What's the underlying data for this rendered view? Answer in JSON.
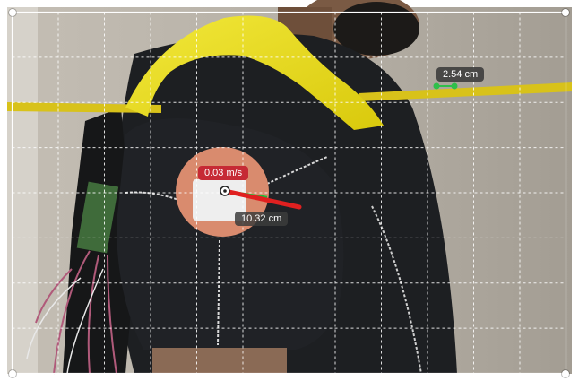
{
  "overlay": {
    "scale_label": "2.54 cm",
    "speed_label": "0.03 m/s",
    "distance_label": "10.32 cm"
  },
  "colors": {
    "grid": "#ffffff",
    "scale_marker": "#2fbf4a",
    "velocity_vector": "#e02020",
    "speed_badge": "#c62a35",
    "tape": "#d8c21a",
    "shirt": "#1d1f22",
    "wall": "#b9b3a9",
    "harness": "#e6db16",
    "sensor_patch": "#d98b6e"
  },
  "icons": [
    "crosshair-icon",
    "corner-handle-icon"
  ]
}
